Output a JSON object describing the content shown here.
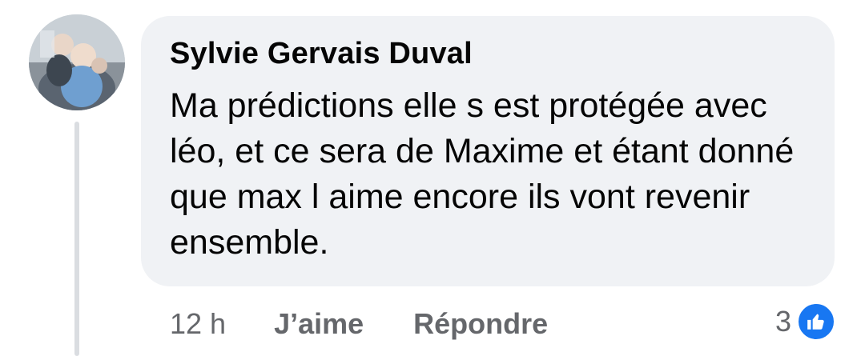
{
  "comment": {
    "author": "Sylvie Gervais Duval",
    "text": "Ma prédictions elle s est protégée avec léo, et ce sera de Maxime et étant donné que max l aime encore ils vont revenir ensemble.",
    "timestamp": "12 h",
    "like_label": "J’aime",
    "reply_label": "Répondre",
    "reaction_count": "3",
    "reaction_icon": "like-thumbs-up-icon"
  },
  "colors": {
    "bubble": "#f0f2f5",
    "secondary_text": "#65676b",
    "primary_text": "#050505",
    "like_blue": "#1877f2",
    "thread_line": "#dadde1"
  }
}
